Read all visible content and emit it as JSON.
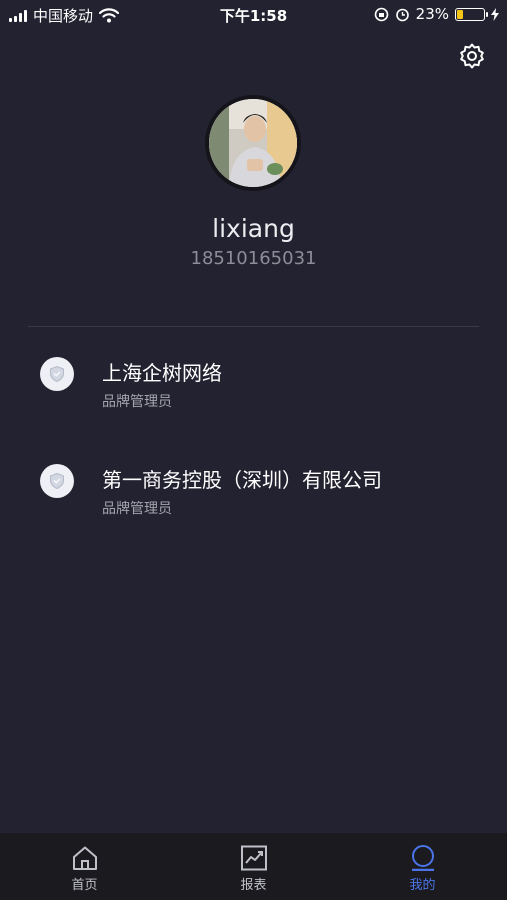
{
  "status_bar": {
    "carrier": "中国移动",
    "time": "下午1:58",
    "battery_percent": "23%",
    "battery_level": 0.23,
    "battery_color": "#f5c518"
  },
  "profile": {
    "username": "lixiang",
    "phone": "18510165031"
  },
  "companies": [
    {
      "name": "上海企树网络",
      "role": "品牌管理员",
      "icon": "shield-icon"
    },
    {
      "name": "第一商务控股（深圳）有限公司",
      "role": "品牌管理员",
      "icon": "shield-icon"
    }
  ],
  "tabs": [
    {
      "label": "首页",
      "icon": "home-icon",
      "active": false
    },
    {
      "label": "报表",
      "icon": "chart-icon",
      "active": false
    },
    {
      "label": "我的",
      "icon": "user-icon",
      "active": true
    }
  ],
  "colors": {
    "background": "#232230",
    "accent": "#4a74e8",
    "tab_bar": "#1a1a1f"
  }
}
